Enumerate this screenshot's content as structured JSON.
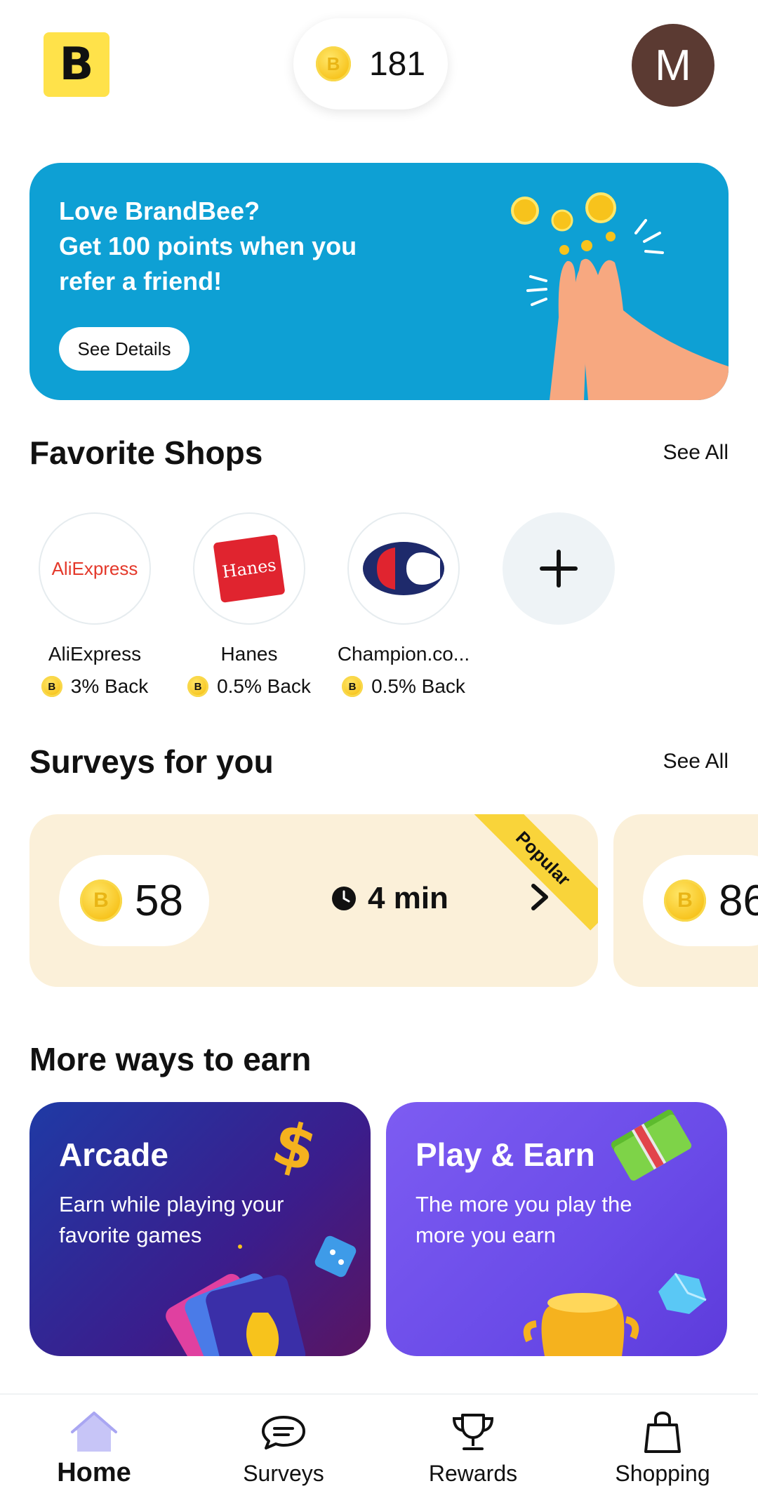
{
  "header": {
    "logo_letter": "B",
    "points": "181",
    "avatar_initial": "M"
  },
  "banner": {
    "line1": "Love BrandBee?",
    "line2": "Get 100 points when you",
    "line3": "refer a friend!",
    "button_label": "See Details"
  },
  "favorite_shops": {
    "title": "Favorite Shops",
    "see_all": "See All",
    "shops": [
      {
        "name": "AliExpress",
        "logo_text": "AliExpress",
        "back": "3% Back"
      },
      {
        "name": "Hanes",
        "logo_text": "Hanes",
        "back": "0.5% Back"
      },
      {
        "name": "Champion.co...",
        "logo_text": "",
        "back": "0.5% Back"
      }
    ],
    "add_icon": "plus-icon"
  },
  "surveys": {
    "title": "Surveys for you",
    "see_all": "See All",
    "cards": [
      {
        "points": "58",
        "time": "4 min",
        "badge": "Popular"
      },
      {
        "points": "86",
        "time": "",
        "badge": ""
      }
    ]
  },
  "more_ways": {
    "title": "More ways to earn",
    "cards": [
      {
        "title": "Arcade",
        "description": "Earn while playing your favorite games"
      },
      {
        "title": "Play & Earn",
        "description": "The more you play the more you earn"
      }
    ]
  },
  "bottom_nav": {
    "items": [
      {
        "label": "Home",
        "icon": "home-icon",
        "active": true
      },
      {
        "label": "Surveys",
        "icon": "chat-icon",
        "active": false
      },
      {
        "label": "Rewards",
        "icon": "trophy-icon",
        "active": false
      },
      {
        "label": "Shopping",
        "icon": "shopping-bag-icon",
        "active": false
      }
    ]
  },
  "colors": {
    "brand_yellow": "#FFE24A",
    "banner_blue": "#0EA0D4",
    "survey_card": "#FBF0D9",
    "avatar_brown": "#5B3A32",
    "active_nav": "#C7C5F7"
  }
}
